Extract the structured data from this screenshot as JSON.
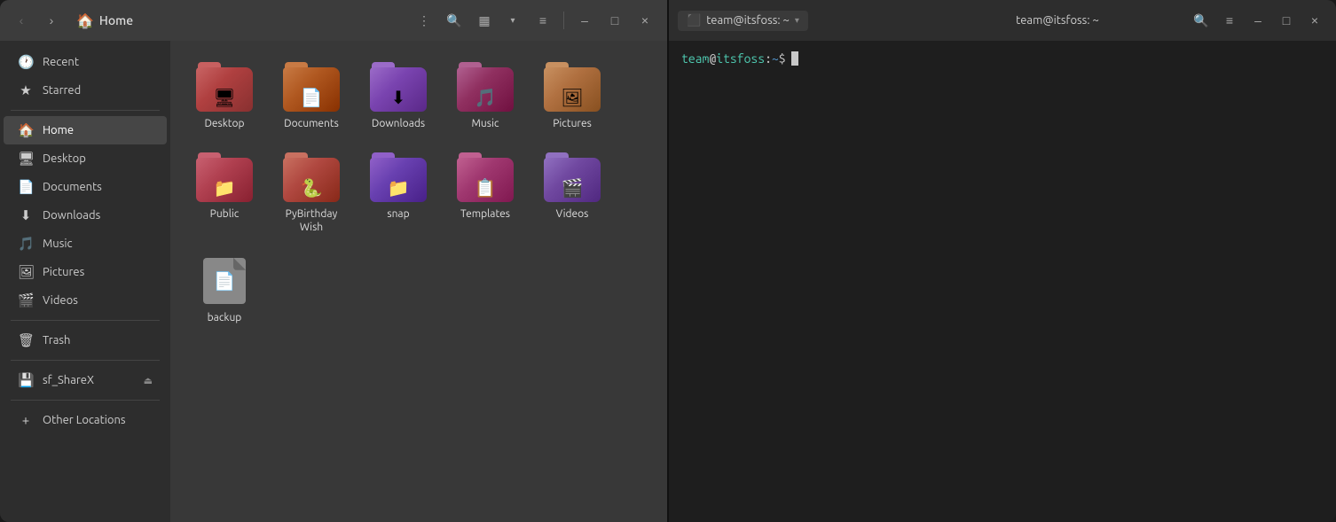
{
  "fileManager": {
    "title": "Home",
    "titlebar": {
      "back_btn": "‹",
      "forward_btn": "›",
      "home_icon": "🏠",
      "menu_btn": "⋮",
      "search_btn": "🔍",
      "view_grid_btn": "▦",
      "view_chevron": "⌄",
      "view_list_btn": "≡",
      "min_btn": "–",
      "max_btn": "□",
      "close_btn": "×"
    },
    "sidebar": {
      "items": [
        {
          "id": "recent",
          "label": "Recent",
          "icon": "🕐"
        },
        {
          "id": "starred",
          "label": "Starred",
          "icon": "★"
        },
        {
          "id": "home",
          "label": "Home",
          "icon": "🏠",
          "active": true
        },
        {
          "id": "desktop",
          "label": "Desktop",
          "icon": "🖥"
        },
        {
          "id": "documents",
          "label": "Documents",
          "icon": "📄"
        },
        {
          "id": "downloads",
          "label": "Downloads",
          "icon": "⬇"
        },
        {
          "id": "music",
          "label": "Music",
          "icon": "🎵"
        },
        {
          "id": "pictures",
          "label": "Pictures",
          "icon": "🖼"
        },
        {
          "id": "videos",
          "label": "Videos",
          "icon": "🎬"
        },
        {
          "id": "trash",
          "label": "Trash",
          "icon": "🗑"
        },
        {
          "id": "sf_sharex",
          "label": "sf_ShareX",
          "icon": "💾",
          "eject": "⏏"
        },
        {
          "id": "other_locations",
          "label": "Other Locations",
          "icon": "+"
        }
      ]
    },
    "files": [
      {
        "id": "desktop",
        "name": "Desktop",
        "type": "folder",
        "variant": "default",
        "overlay": "🖥"
      },
      {
        "id": "documents",
        "name": "Documents",
        "type": "folder",
        "variant": "documents",
        "overlay": "📄"
      },
      {
        "id": "downloads",
        "name": "Downloads",
        "type": "folder",
        "variant": "downloads",
        "overlay": "⬇"
      },
      {
        "id": "music",
        "name": "Music",
        "type": "folder",
        "variant": "music",
        "overlay": "🎵"
      },
      {
        "id": "pictures",
        "name": "Pictures",
        "type": "folder",
        "variant": "pictures",
        "overlay": "🖼"
      },
      {
        "id": "public",
        "name": "Public",
        "type": "folder",
        "variant": "public",
        "overlay": "📁"
      },
      {
        "id": "pybirthday",
        "name": "PyBirthday Wish",
        "type": "folder",
        "variant": "pybirthday",
        "overlay": "🐍"
      },
      {
        "id": "snap",
        "name": "snap",
        "type": "folder",
        "variant": "snap",
        "overlay": "📁"
      },
      {
        "id": "templates",
        "name": "Templates",
        "type": "folder",
        "variant": "templates",
        "overlay": "📋"
      },
      {
        "id": "videos",
        "name": "Videos",
        "type": "folder",
        "variant": "videos",
        "overlay": "🎬"
      },
      {
        "id": "backup",
        "name": "backup",
        "type": "file",
        "overlay": "📄"
      }
    ]
  },
  "terminal": {
    "tab_icon": "⬛",
    "tab_label": "team@itsfoss: ~",
    "title": "team@itsfoss: ~",
    "toolbar": {
      "search_btn": "🔍",
      "menu_btn": "≡",
      "min_btn": "–",
      "max_btn": "□",
      "close_btn": "×"
    },
    "prompt": {
      "user": "team",
      "at": "@",
      "host": "itsfoss",
      "colon": ":",
      "tilde": " ~",
      "dollar": "$"
    }
  }
}
